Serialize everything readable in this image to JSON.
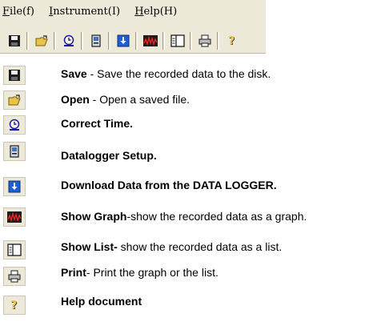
{
  "menubar": {
    "items": [
      {
        "mnemonic": "F",
        "rest": "ile(f)"
      },
      {
        "mnemonic": "I",
        "rest": "nstrument(I)"
      },
      {
        "mnemonic": "H",
        "rest": "elp(H)"
      }
    ]
  },
  "toolbar": {
    "buttons": [
      {
        "icon": "save-icon"
      },
      {
        "icon": "open-folder-icon"
      },
      {
        "icon": "clock-icon"
      },
      {
        "icon": "datalogger-setup-icon"
      },
      {
        "icon": "download-arrow-icon"
      },
      {
        "icon": "graph-icon"
      },
      {
        "icon": "list-icon"
      },
      {
        "icon": "printer-icon"
      },
      {
        "icon": "help-icon"
      }
    ]
  },
  "legend": {
    "items": [
      {
        "icon": "save-icon",
        "title": "Save",
        "desc": " - Save the recorded data to the disk."
      },
      {
        "icon": "open-folder-icon",
        "title": "Open",
        "desc": " - Open a saved file."
      },
      {
        "icon": "clock-icon",
        "title": "Correct Time.",
        "desc": ""
      },
      {
        "icon": "datalogger-setup-icon",
        "title": "Datalogger Setup.",
        "desc": ""
      },
      {
        "icon": "download-arrow-icon",
        "title": "Download Data from the DATA LOGGER.",
        "desc": ""
      },
      {
        "icon": "graph-icon",
        "title": "Show Graph",
        "desc": "-show the recorded data as a graph."
      },
      {
        "icon": "list-icon",
        "title": "Show List-",
        "desc": " show the recorded data as a list."
      },
      {
        "icon": "printer-icon",
        "title": "Print",
        "desc": "- Print the graph or the list."
      },
      {
        "icon": "help-icon",
        "title": "Help document",
        "desc": ""
      }
    ]
  }
}
